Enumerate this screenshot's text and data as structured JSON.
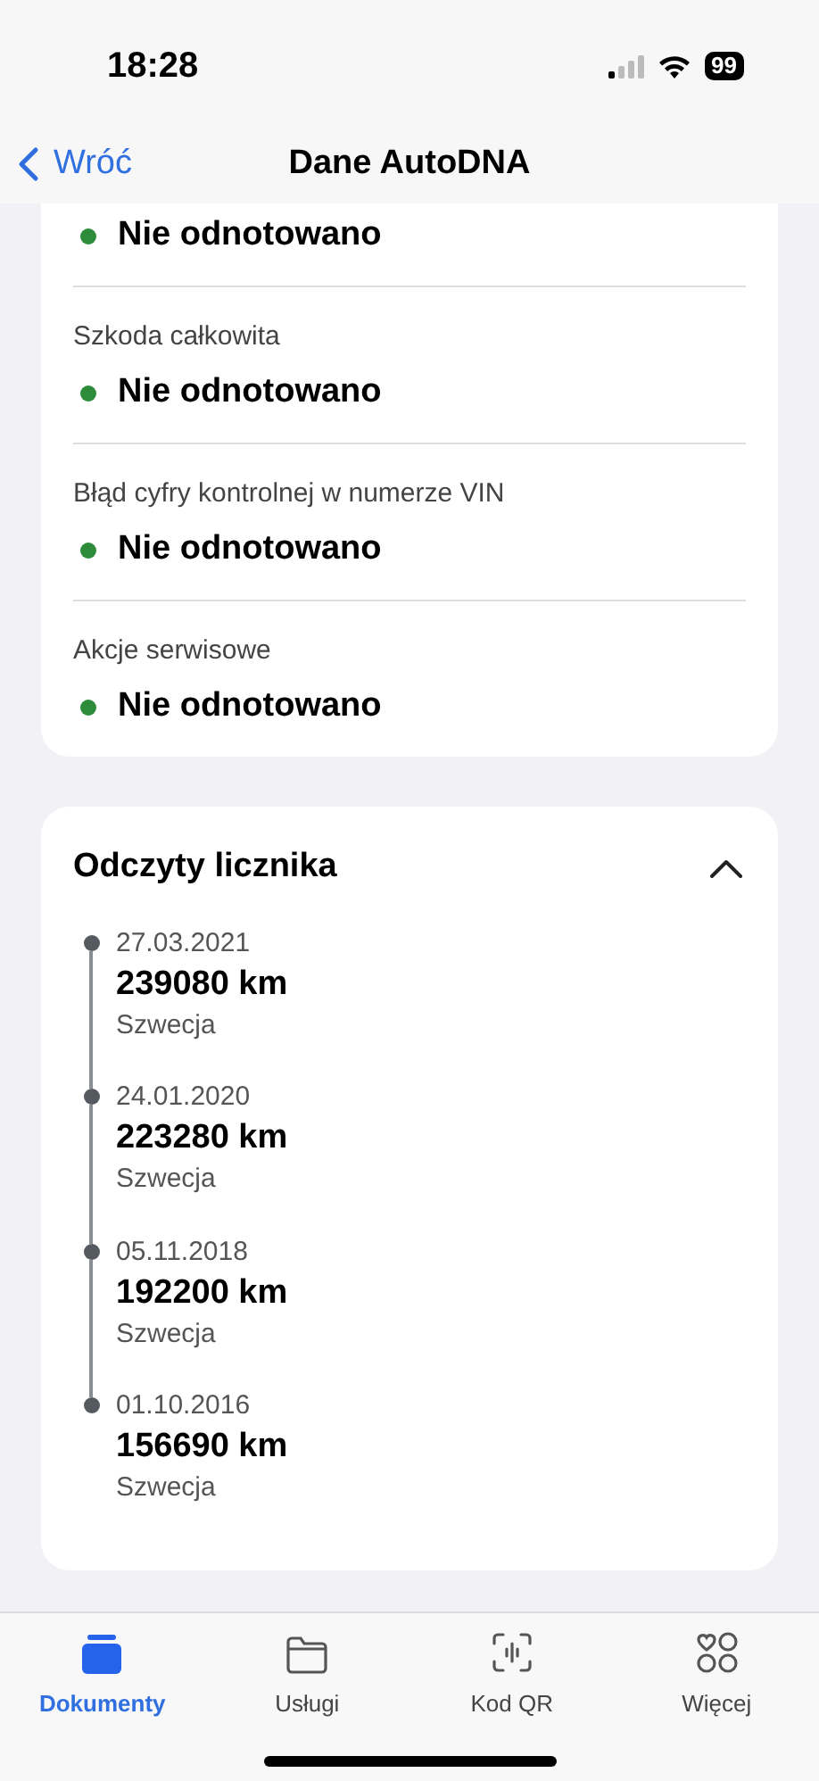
{
  "status_bar": {
    "time": "18:28",
    "battery": "99"
  },
  "nav": {
    "back": "Wróć",
    "title": "Dane AutoDNA"
  },
  "checks": [
    {
      "status": "Nie odnotowano",
      "color": "#2e8b3a"
    },
    {
      "label": "Szkoda całkowita",
      "status": "Nie odnotowano",
      "color": "#2e8b3a"
    },
    {
      "label": "Błąd cyfry kontrolnej w numerze VIN",
      "status": "Nie odnotowano",
      "color": "#2e8b3a"
    },
    {
      "label": "Akcje serwisowe",
      "status": "Nie odnotowano",
      "color": "#2e8b3a"
    }
  ],
  "odometer": {
    "title": "Odczyty licznika",
    "expanded": true,
    "readings": [
      {
        "date": "27.03.2021",
        "mileage": "239080 km",
        "country": "Szwecja"
      },
      {
        "date": "24.01.2020",
        "mileage": "223280 km",
        "country": "Szwecja"
      },
      {
        "date": "05.11.2018",
        "mileage": "192200 km",
        "country": "Szwecja"
      },
      {
        "date": "01.10.2016",
        "mileage": "156690 km",
        "country": "Szwecja"
      }
    ]
  },
  "tabs": [
    {
      "kind": "documents",
      "label": "Dokumenty",
      "selected": true
    },
    {
      "kind": "services",
      "label": "Usługi",
      "selected": false
    },
    {
      "kind": "qr",
      "label": "Kod QR",
      "selected": false
    },
    {
      "kind": "more",
      "label": "Więcej",
      "selected": false
    }
  ]
}
